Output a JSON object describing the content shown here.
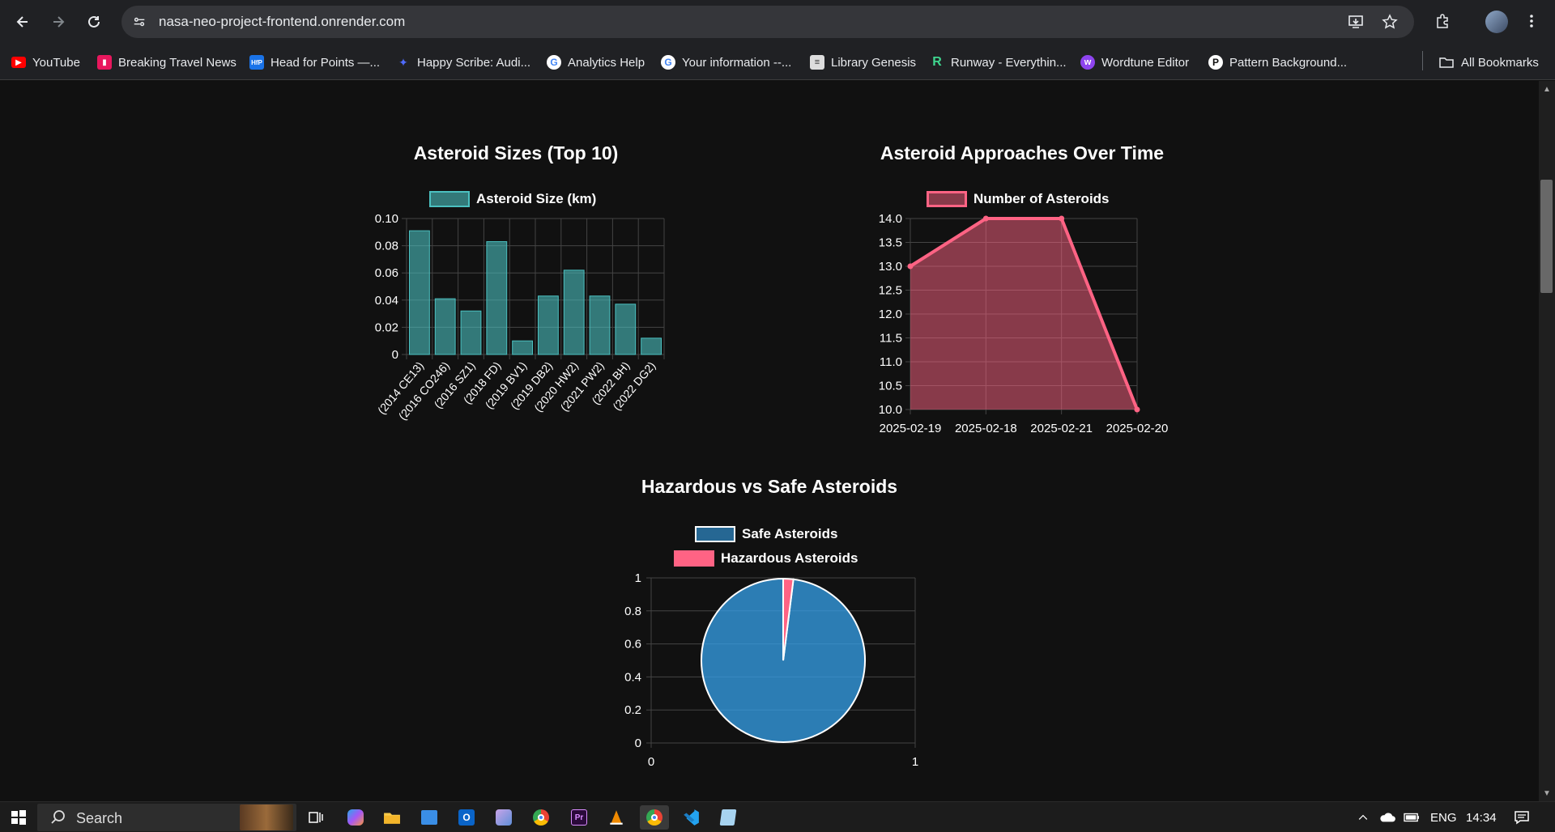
{
  "browser": {
    "url": "nasa-neo-project-frontend.onrender.com"
  },
  "bookmarks": [
    {
      "label": "YouTube",
      "icon": "youtube-icon",
      "color": "#ff0000"
    },
    {
      "label": "Breaking Travel News",
      "icon": "btn-icon",
      "color": "#e8175d"
    },
    {
      "label": "Head for Points —...",
      "icon": "hfp-icon",
      "color": "#1a73e8"
    },
    {
      "label": "Happy Scribe: Audi...",
      "icon": "happyscribe-icon",
      "color": "#4f6bff"
    },
    {
      "label": "Analytics Help",
      "icon": "google-icon",
      "color": "#4285f4"
    },
    {
      "label": "Your information --...",
      "icon": "google-icon",
      "color": "#4285f4"
    },
    {
      "label": "Library Genesis",
      "icon": "libgen-icon",
      "color": "#dddddd"
    },
    {
      "label": "Runway - Everythin...",
      "icon": "runway-icon",
      "color": "#3fd68f"
    },
    {
      "label": "Wordtune Editor",
      "icon": "wordtune-icon",
      "color": "#8e44ef"
    },
    {
      "label": "Pattern Background...",
      "icon": "pattern-icon",
      "color": "#ffffff"
    }
  ],
  "all_bookmarks_label": "All Bookmarks",
  "chart_data": [
    {
      "type": "bar",
      "title": "Asteroid Sizes (Top 10)",
      "legend": "Asteroid Size (km)",
      "categories": [
        "(2014 CE13)",
        "(2016 CO246)",
        "(2016 SZ1)",
        "(2018 FD)",
        "(2019 BV1)",
        "(2019 DB2)",
        "(2020 HW2)",
        "(2021 PW2)",
        "(2022 BH)",
        "(2022 DG2)"
      ],
      "values": [
        0.091,
        0.041,
        0.032,
        0.083,
        0.01,
        0.043,
        0.062,
        0.043,
        0.037,
        0.012
      ],
      "ylim": [
        0,
        0.1
      ],
      "yticks": [
        "0",
        "0.02",
        "0.04",
        "0.06",
        "0.08",
        "0.10"
      ],
      "color": "#4bc0c0",
      "grid": true,
      "legend_position": "top"
    },
    {
      "type": "area",
      "title": "Asteroid Approaches Over Time",
      "legend": "Number of Asteroids",
      "categories": [
        "2025-02-19",
        "2025-02-18",
        "2025-02-21",
        "2025-02-20"
      ],
      "values": [
        13,
        14,
        14,
        10
      ],
      "ylim": [
        10,
        14
      ],
      "yticks": [
        "10.0",
        "10.5",
        "11.0",
        "11.5",
        "12.0",
        "12.5",
        "13.0",
        "13.5",
        "14.0"
      ],
      "color": "#ff6384",
      "grid": true,
      "legend_position": "top"
    },
    {
      "type": "pie",
      "title": "Hazardous vs Safe Asteroids",
      "labels": [
        "Safe Asteroids",
        "Hazardous Asteroids"
      ],
      "values": [
        0.98,
        0.02
      ],
      "colors": [
        "#36a2eb",
        "#ff6384"
      ],
      "yticks": [
        "0",
        "0.2",
        "0.4",
        "0.6",
        "0.8",
        "1"
      ],
      "xticks": [
        "0",
        "1"
      ],
      "grid": true,
      "legend_position": "top"
    }
  ],
  "taskbar": {
    "search_placeholder": "Search",
    "language": "ENG",
    "time": "14:34"
  }
}
